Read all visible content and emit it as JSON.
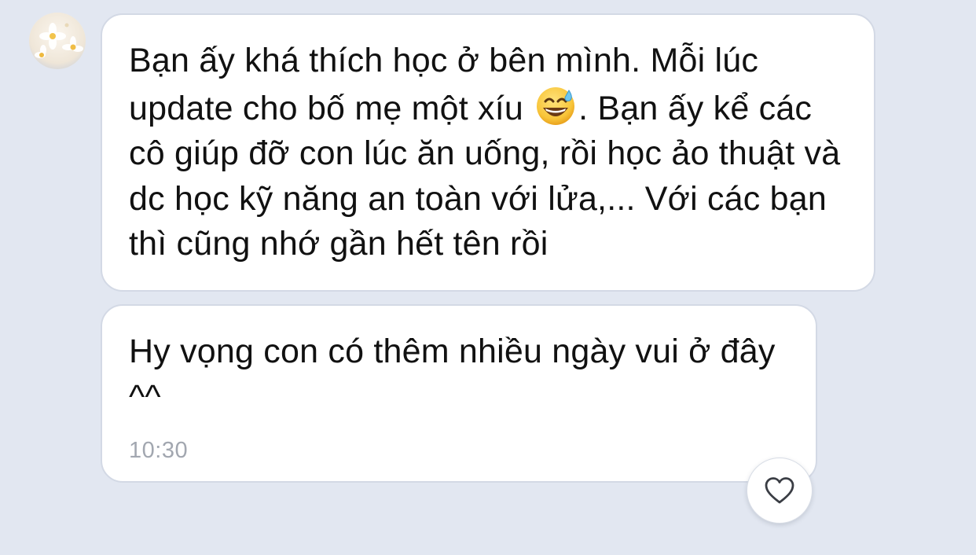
{
  "conversation": {
    "sender": {
      "avatar_icon": "flower-avatar"
    },
    "messages": [
      {
        "text_before_emoji": "Bạn ấy khá thích học ở bên mình. Mỗi lúc update cho bố mẹ một xíu ",
        "emoji_icon": "grinning-face-with-sweat-emoji",
        "text_after_emoji": ". Bạn ấy kể các cô giúp đỡ con lúc ăn uống, rồi học ảo thuật và dc học kỹ năng an toàn với lửa,... Với các bạn thì cũng nhớ gần hết tên rồi"
      },
      {
        "text": "Hy vọng con có thêm nhiều ngày vui ở đây ^^",
        "time": "10:30",
        "reaction_icon": "heart-outline-icon"
      }
    ]
  },
  "colors": {
    "background": "#e2e7f1",
    "bubble": "#ffffff",
    "bubble_border": "#d3d9e5",
    "text": "#111111",
    "timestamp": "#a2a7b0"
  }
}
